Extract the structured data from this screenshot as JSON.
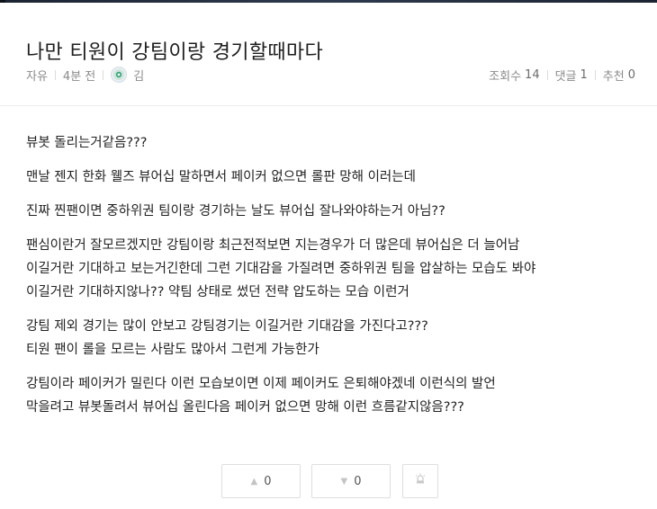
{
  "post": {
    "title": "나만 티원이 강팀이랑 경기할때마다",
    "category": "자유",
    "time": "4분 전",
    "author": "김",
    "views_label": "조회수",
    "views": "14",
    "comments_label": "댓글",
    "comments": "1",
    "likes_label": "추천",
    "likes": "0"
  },
  "content": {
    "paragraphs": [
      [
        "뷰봇 돌리는거같음???"
      ],
      [
        "맨날 젠지 한화 웰즈 뷰어십 말하면서 페이커 없으면 롤판 망해 이러는데"
      ],
      [
        "진짜 찐팬이면 중하위권 팀이랑 경기하는 날도 뷰어십 잘나와야하는거 아님??"
      ],
      [
        "팬심이란거 잘모르겠지만 강팀이랑 최근전적보면 지는경우가 더 많은데 뷰어십은 더 늘어남",
        "이길거란 기대하고 보는거긴한데 그런 기대감을 가질려면 중하위권 팀을 압살하는 모습도 봐야",
        "이길거란 기대하지않나?? 약팀 상태로 썼던 전략 압도하는 모습 이런거"
      ],
      [
        "강팀 제외 경기는 많이 안보고 강팀경기는 이길거란 기대감을 가진다고???",
        "티원 팬이 롤을 모르는 사람도 많아서 그런게 가능한가"
      ],
      [
        "강팀이라 페이커가 밀린다 이런 모습보이면 이제 페이커도 은퇴해야겠네 이런식의 발언",
        "막을려고 뷰봇돌려서 뷰어십 올린다음 페이커 없으면 망해 이런 흐름같지않음???"
      ]
    ]
  },
  "votes": {
    "up": "0",
    "down": "0"
  },
  "icons": {
    "up": "triangle-up-icon",
    "down": "triangle-down-icon",
    "report": "siren-icon",
    "avatar": "avatar-icon"
  }
}
